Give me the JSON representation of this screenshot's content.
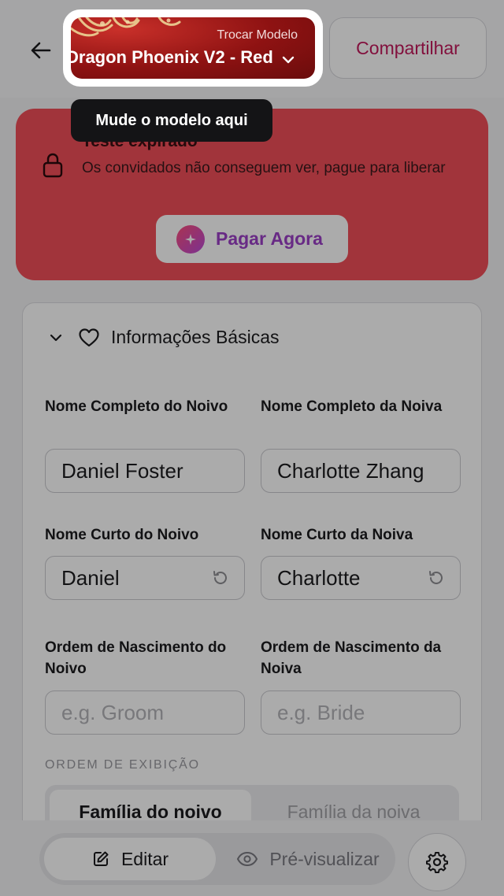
{
  "header": {
    "template_subtitle": "Trocar Modelo",
    "template_name": "Dragon Phoenix V2 - Red",
    "share_label": "Compartilhar"
  },
  "tooltip": {
    "text": "Mude o modelo aqui"
  },
  "banner": {
    "title": "Teste expirado",
    "message": "Os convidados não conseguem ver, pague para liberar",
    "pay_label": "Pagar Agora"
  },
  "basic_info": {
    "section_title": "Informações Básicas",
    "groom_full_name_label": "Nome Completo do Noivo",
    "groom_full_name_value": "Daniel Foster",
    "bride_full_name_label": "Nome Completo da Noiva",
    "bride_full_name_value": "Charlotte Zhang",
    "groom_short_name_label": "Nome Curto do Noivo",
    "groom_short_name_value": "Daniel",
    "bride_short_name_label": "Nome Curto da Noiva",
    "bride_short_name_value": "Charlotte",
    "groom_birth_order_label": "Ordem de Nascimento do Noivo",
    "groom_birth_order_placeholder": "e.g. Groom",
    "bride_birth_order_label": "Ordem de Nascimento da Noiva",
    "bride_birth_order_placeholder": "e.g. Bride",
    "display_order_caption": "ORDEM DE EXIBIÇÃO",
    "display_order_options": [
      "Família do noivo",
      "Família da noiva"
    ],
    "display_order_selected": "Família do noivo"
  },
  "bottom_bar": {
    "edit_label": "Editar",
    "preview_label": "Pré-visualizar",
    "active_mode": "Editar"
  },
  "colors": {
    "banner_bg": "#f14e58",
    "share_text": "#c2185b",
    "pay_text": "#9c3fc7",
    "template_red": "#8e1212"
  },
  "icons": {
    "back": "arrow-left-icon",
    "template_dropdown": "chevron-down-icon",
    "lock": "lock-icon",
    "pay": "sparkle-icon",
    "section_toggle": "chevron-down-icon",
    "section": "heart-icon",
    "reset": "reset-icon",
    "edit": "edit-icon",
    "preview": "eye-icon",
    "settings": "gear-icon"
  }
}
